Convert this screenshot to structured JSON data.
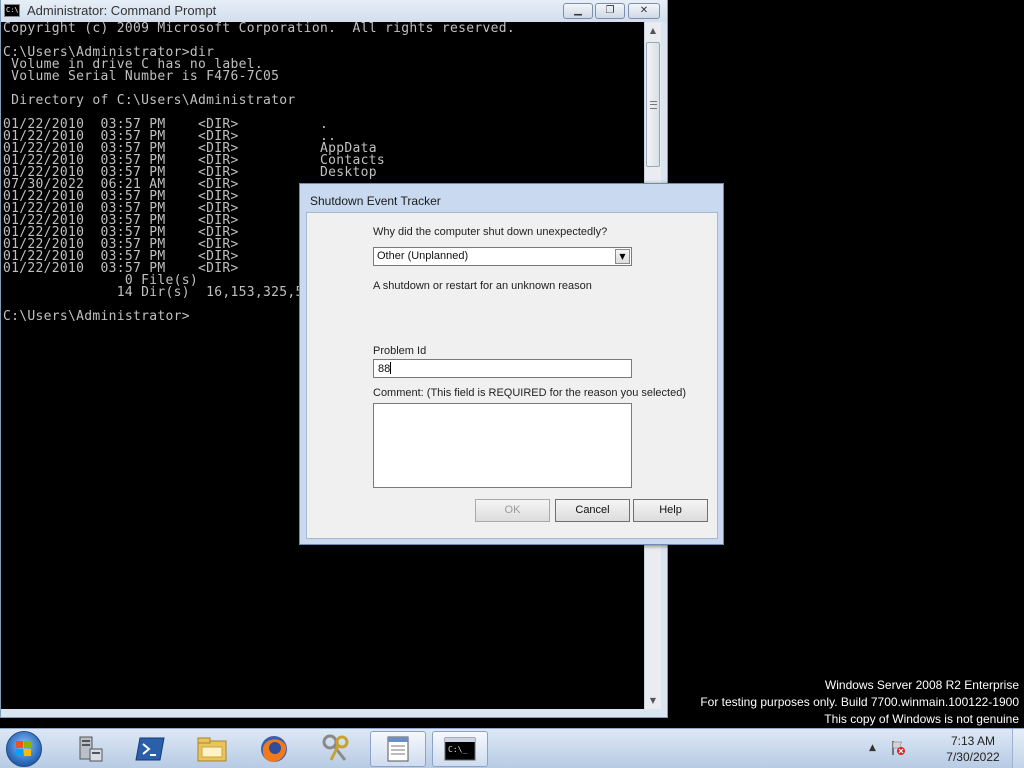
{
  "cmd_window": {
    "title": "Administrator: Command Prompt",
    "icon_label": "C:\\",
    "controls": {
      "minimize": "▁",
      "maximize": "❐",
      "close": "✕"
    },
    "console_lines": [
      "Copyright (c) 2009 Microsoft Corporation.  All rights reserved.",
      "",
      "C:\\Users\\Administrator>dir",
      " Volume in drive C has no label.",
      " Volume Serial Number is F476-7C05",
      "",
      " Directory of C:\\Users\\Administrator",
      "",
      "01/22/2010  03:57 PM    <DIR>          .",
      "01/22/2010  03:57 PM    <DIR>          ..",
      "01/22/2010  03:57 PM    <DIR>          AppData",
      "01/22/2010  03:57 PM    <DIR>          Contacts",
      "01/22/2010  03:57 PM    <DIR>          Desktop",
      "07/30/2022  06:21 AM    <DIR>",
      "01/22/2010  03:57 PM    <DIR>",
      "01/22/2010  03:57 PM    <DIR>",
      "01/22/2010  03:57 PM    <DIR>",
      "01/22/2010  03:57 PM    <DIR>",
      "01/22/2010  03:57 PM    <DIR>",
      "01/22/2010  03:57 PM    <DIR>",
      "01/22/2010  03:57 PM    <DIR>",
      "               0 File(s)",
      "              14 Dir(s)  16,153,325,5",
      "",
      "C:\\Users\\Administrator>"
    ]
  },
  "dialog": {
    "title": "Shutdown Event Tracker",
    "why_label": "Why did the computer shut down unexpectedly?",
    "reason_selected": "Other (Unplanned)",
    "reason_description": "A shutdown or restart for an unknown reason",
    "problem_id_label": "Problem Id",
    "problem_id_value": "88",
    "comment_label": "Comment: (This field is REQUIRED for the reason you selected)",
    "comment_value": "",
    "buttons": {
      "ok": "OK",
      "cancel": "Cancel",
      "help": "Help"
    }
  },
  "watermark": {
    "line1": "Windows Server 2008 R2 Enterprise",
    "line2": "For testing purposes only. Build 7700.winmain.100122-1900",
    "line3": "This copy of Windows is not genuine"
  },
  "taskbar": {
    "items": [
      "server-manager-icon",
      "powershell-icon",
      "explorer-icon",
      "firefox-icon",
      "keys-icon",
      "notepad-icon",
      "cmd-icon"
    ],
    "active_item": "cmd-icon",
    "clock_time": "7:13 AM",
    "clock_date": "7/30/2022",
    "tray_chevron": "▲"
  }
}
